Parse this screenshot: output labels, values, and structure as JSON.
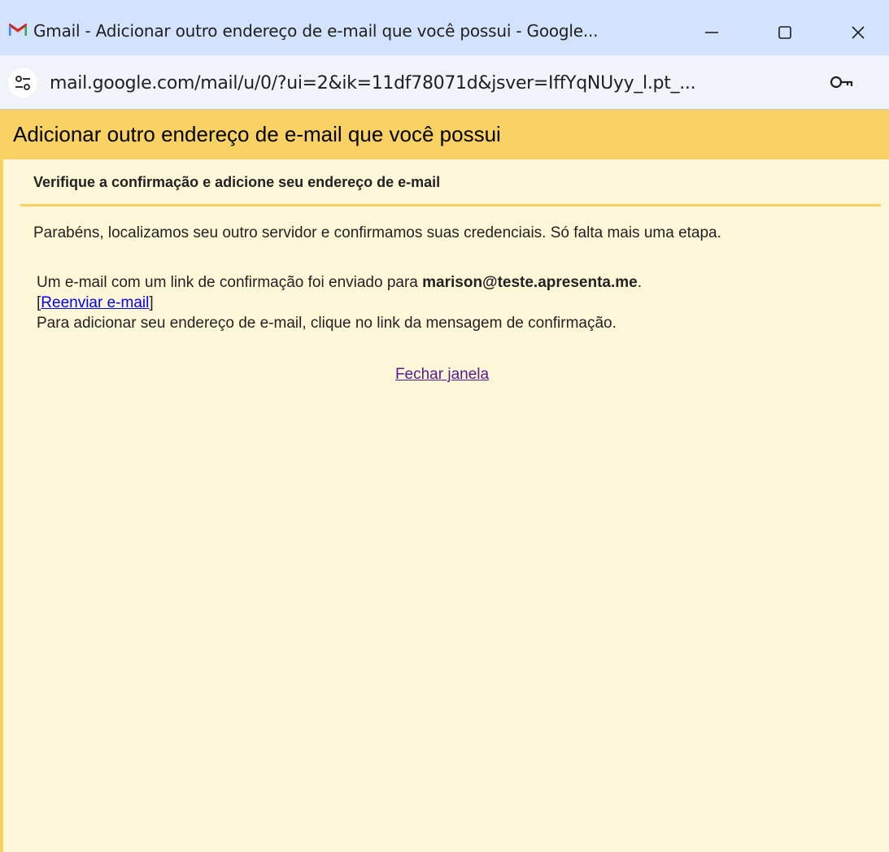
{
  "window": {
    "title": "Gmail - Adicionar outro endereço de e-mail que você possui - Google...",
    "url": "mail.google.com/mail/u/0/?ui=2&ik=11df78071d&jsver=IffYqNUyy_l.pt_..."
  },
  "page": {
    "header": "Adicionar outro endereço de e-mail que você possui",
    "subheading": "Verifique a confirmação e adicione seu endereço de e-mail",
    "success_message": "Parabéns, localizamos seu outro servidor e confirmamos suas credenciais. Só falta mais uma etapa.",
    "confirmation_prefix": "Um e-mail com um link de confirmação foi enviado para ",
    "email": "marison@teste.apresenta.me",
    "period": ".",
    "bracket_open": "[",
    "resend_link": "Reenviar e-mail",
    "bracket_close": "]",
    "instruction": "Para adicionar seu endereço de e-mail, clique no link da mensagem de confirmação.",
    "close_link": "Fechar janela"
  },
  "colors": {
    "titlebar_bg": "#d3e3fd",
    "page_bg": "#fff7d7",
    "header_bg": "#fad163",
    "link": "#0000ee",
    "visited_link": "#551a8b"
  },
  "icons": {
    "app": "gmail-icon",
    "minimize": "minimize-icon",
    "maximize": "maximize-icon",
    "close": "close-icon",
    "site_info": "site-info-icon",
    "password": "key-icon"
  }
}
